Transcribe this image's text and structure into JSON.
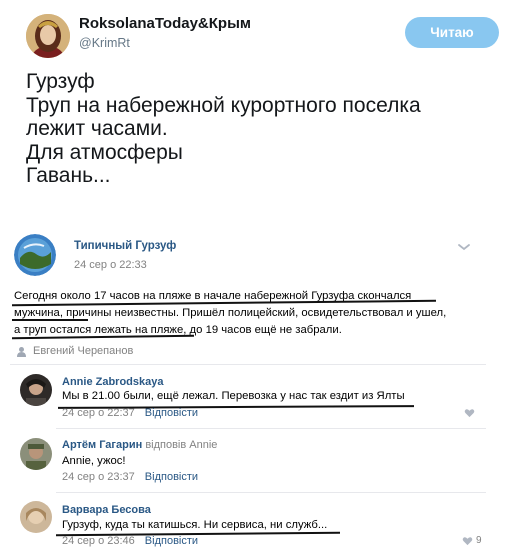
{
  "tweet": {
    "name": "RoksolanaToday&Крым",
    "handle": "@KrimRt",
    "follow_label": "Читаю",
    "lines": [
      "Гурзуф",
      "Труп на набережной курортного поселка",
      "лежит часами.",
      "Для атмосферы",
      "Гавань..."
    ]
  },
  "vk": {
    "group_name": "Типичный Гурзуф",
    "post_date": "24 сер о 22:33",
    "post_lines": [
      "Сегодня около 17 часов на пляже в начале набережной Гурзуфа скончался",
      "мужчина, причины неизвестны. Пришёл полицейский, освидетельствовал и ушел,",
      "а труп остался лежать на пляже, до 19 часов ещё не забрали."
    ],
    "author": "Евгений Черепанов",
    "comments": [
      {
        "name": "Annie Zabrodskaya",
        "reply_to": "",
        "text": "Мы в 21.00 были, ещё лежал. Перевозка у нас так ездит из Ялты",
        "date": "24 сер о 22:37",
        "reply_label": "Відповісти",
        "likes": ""
      },
      {
        "name": "Артём Гагарин",
        "reply_to": "відповів Annie",
        "text": "Annie, ужос!",
        "date": "24 сер о 23:37",
        "reply_label": "Відповісти",
        "likes": ""
      },
      {
        "name": "Варвара Бесова",
        "reply_to": "",
        "text": "Гурзуф, куда ты катишься. Ни сервиса, ни служб...",
        "date": "24 сер о 23:46",
        "reply_label": "Відповісти",
        "likes": "9"
      }
    ]
  },
  "icons": {
    "chevron": "chevron-down-icon",
    "user": "user-icon",
    "heart": "heart-icon"
  },
  "colors": {
    "twitter_follow": "#89c7f0",
    "vk_link": "#2a5885",
    "muted": "#828282"
  }
}
